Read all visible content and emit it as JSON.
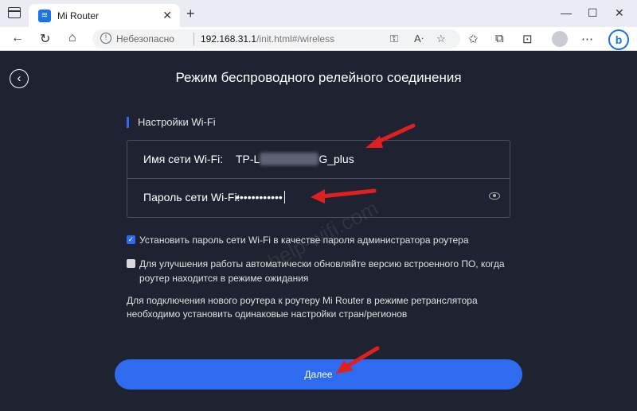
{
  "browser": {
    "tab_title": "Mi Router",
    "security_label": "Небезопасно",
    "url_host": "192.168.31.1",
    "url_path": "/init.html#/wireless",
    "icons": [
      "sidebar-icon",
      "back-icon",
      "reload-icon",
      "home-icon",
      "warning-icon",
      "key-icon",
      "read-aloud-icon",
      "favorite-icon",
      "favorites-icon",
      "collections-icon",
      "edge-icon",
      "profile-icon",
      "more-icon",
      "bing-icon"
    ]
  },
  "page": {
    "title": "Режим беспроводного релейного соединения",
    "section_label": "Настройки Wi-Fi",
    "ssid_label": "Имя сети Wi-Fi:",
    "ssid_prefix": "TP-L",
    "ssid_suffix": "G_plus",
    "password_label": "Пароль сети Wi-Fi:",
    "password_value": "••••••••••••",
    "checkbox1": {
      "checked": true,
      "label": "Установить пароль сети Wi-Fi в качестве пароля администратора роутера"
    },
    "checkbox2": {
      "checked": false,
      "label": "Для улучшения работы автоматически обновляйте версию встроенного ПО, когда роутер находится в режиме ожидания"
    },
    "info": "Для подключения нового роутера к роутеру Mi Router в режиме ретранслятора необходимо установить одинаковые настройки стран/регионов",
    "next_button": "Далее",
    "watermark": "help-wifi.com"
  },
  "colors": {
    "page_bg": "#1f2230",
    "accent": "#2f6bf0",
    "annotation_arrow": "#e02020"
  }
}
